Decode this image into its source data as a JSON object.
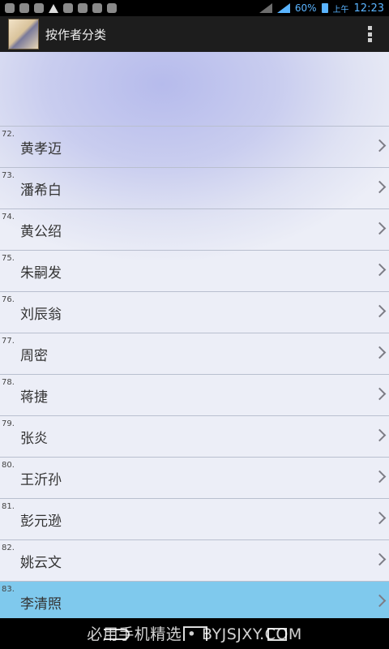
{
  "status_bar": {
    "battery_percent": "60%",
    "ampm": "上午",
    "time": "12:23"
  },
  "action_bar": {
    "title": "按作者分类"
  },
  "authors": [
    {
      "index": "72.",
      "name": "黄孝迈"
    },
    {
      "index": "73.",
      "name": "潘希白"
    },
    {
      "index": "74.",
      "name": "黄公绍"
    },
    {
      "index": "75.",
      "name": "朱嗣发"
    },
    {
      "index": "76.",
      "name": "刘辰翁"
    },
    {
      "index": "77.",
      "name": "周密"
    },
    {
      "index": "78.",
      "name": "蒋捷"
    },
    {
      "index": "79.",
      "name": "张炎"
    },
    {
      "index": "80.",
      "name": "王沂孙"
    },
    {
      "index": "81.",
      "name": "彭元逊"
    },
    {
      "index": "82.",
      "name": "姚云文"
    },
    {
      "index": "83.",
      "name": "李清照"
    }
  ],
  "selected_index": 11,
  "watermark": "必用手机精选 • BYJSJXY.COM",
  "colors": {
    "selected_row": "#7fc9ed",
    "status_accent": "#5ab4ff"
  }
}
